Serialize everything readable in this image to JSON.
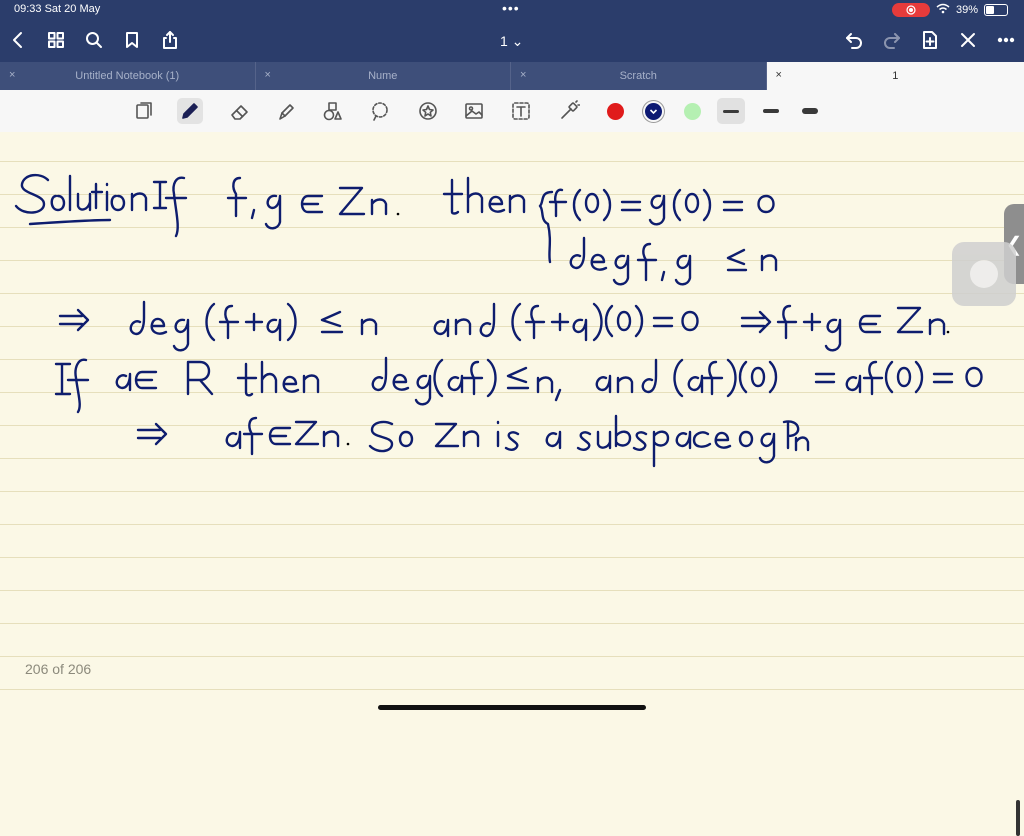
{
  "status_bar": {
    "time": "09:33  Sat 20 May",
    "battery": "39%"
  },
  "nav": {
    "page_selector": "1 ⌄"
  },
  "tabs": [
    {
      "label": "Untitled Notebook (1)",
      "active": false
    },
    {
      "label": "Nume",
      "active": false
    },
    {
      "label": "Scratch",
      "active": false
    },
    {
      "label": "1",
      "active": true
    }
  ],
  "tab_close_glyph": "×",
  "toolbar": {
    "tools": [
      "pages-icon",
      "pen-icon",
      "eraser-icon",
      "highlighter-icon",
      "shapes-icon",
      "lasso-icon",
      "sticker-icon",
      "image-icon",
      "text-icon",
      "laser-pointer-icon"
    ],
    "colors": [
      "#e01b1b",
      "#0d1a73",
      "#b5f0b2"
    ],
    "thickness_levels": [
      "thin",
      "medium",
      "thick"
    ]
  },
  "page": {
    "counter": "206 of 206",
    "ink_color": "#0e1d6e",
    "lines": [
      "Solution If f,g ∈ Zn. then { f(0) = g(0) = 0 ; deg f,g ≤ n",
      "⇒ deg (f+g) ≤ n and (f+g)(0) = 0 ⇒ f+g ∈ Zn.",
      "If a ∈ R then deg (af) ≤ n, and (af)(0) = af(0) = 0",
      "⇒ af ∈ Zn. So Zn is a subspace of Pn"
    ]
  }
}
